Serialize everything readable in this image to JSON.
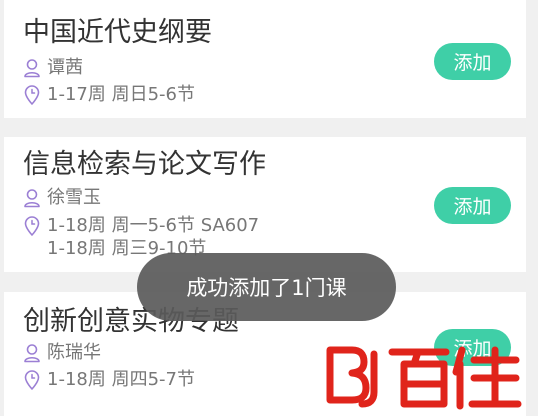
{
  "courses": [
    {
      "name": "中国近代史纲要",
      "teacher": "谭茜",
      "schedule": [
        "1-17周 周日5-6节"
      ],
      "add_label": "添加"
    },
    {
      "name": "信息检索与论文写作",
      "teacher": "徐雪玉",
      "schedule": [
        "1-18周 周一5-6节 SA607",
        "1-18周 周三9-10节"
      ],
      "add_label": "添加"
    },
    {
      "name": "创新创意实物专题",
      "teacher": "陈瑞华",
      "schedule": [
        "1-18周 周四5-7节"
      ],
      "add_label": "添加"
    }
  ],
  "toast": {
    "message": "成功添加了1门课"
  },
  "watermark": {
    "text": "BJ百佳"
  },
  "colors": {
    "accent": "#3fcfa7",
    "icon": "#9b7fd4",
    "watermark": "#e0241b",
    "background": "#f0f0f0"
  },
  "icons": {
    "teacher": "person-icon",
    "schedule": "location-pin-icon"
  }
}
